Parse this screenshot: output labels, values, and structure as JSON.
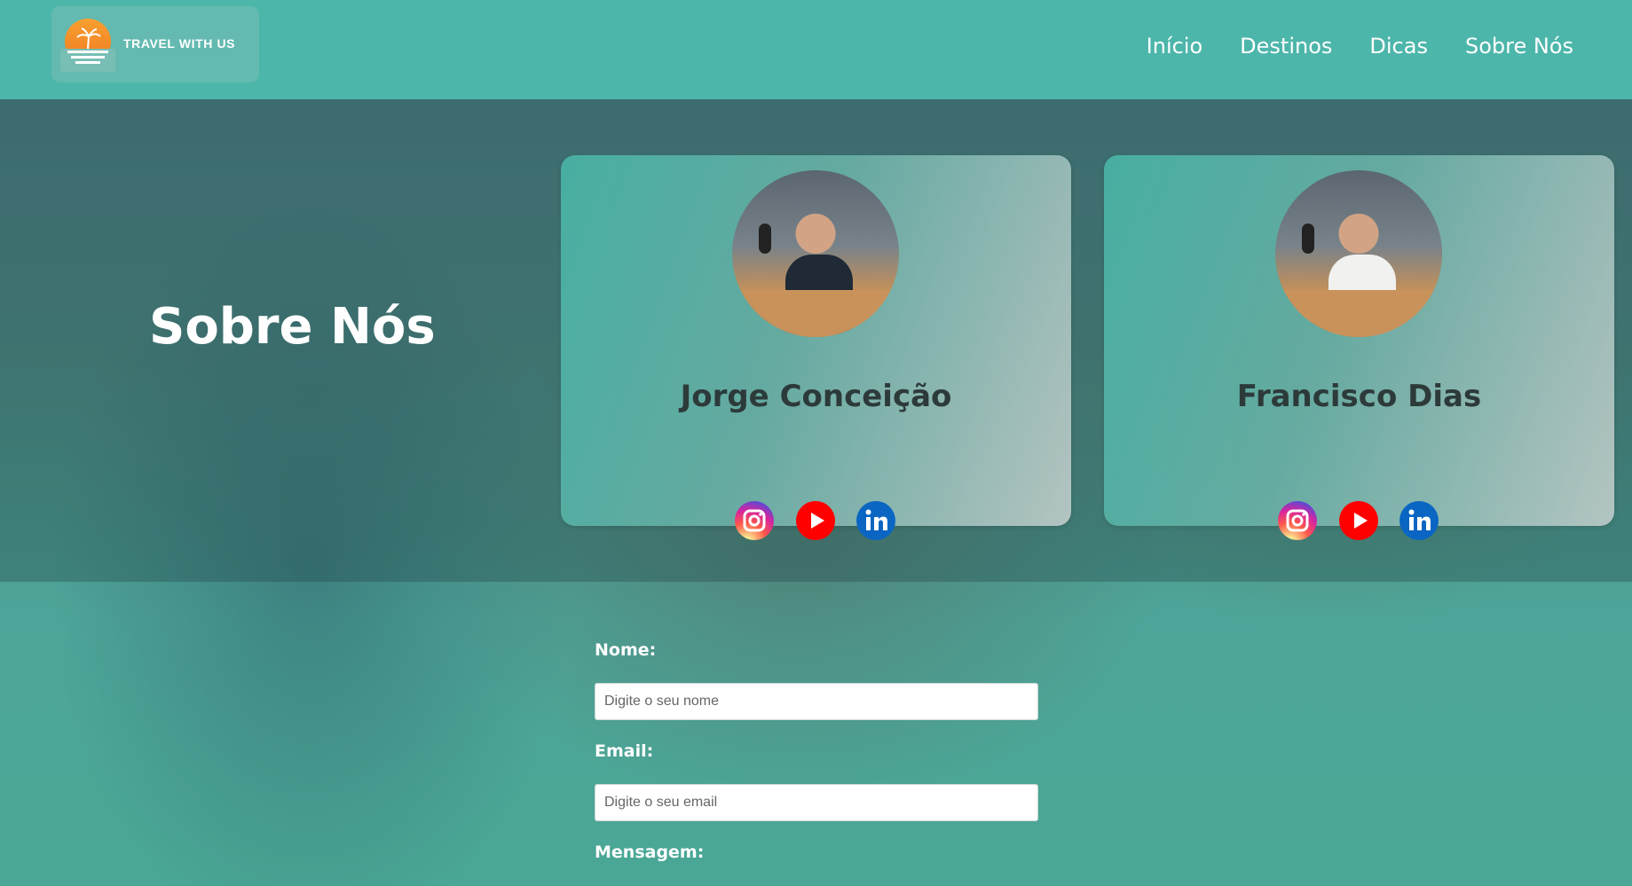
{
  "header": {
    "logo_text": "TRAVEL WITH US",
    "nav": [
      "Início",
      "Destinos",
      "Dicas",
      "Sobre Nós"
    ]
  },
  "hero": {
    "title": "Sobre Nós",
    "members": [
      {
        "name": "Jorge Conceição",
        "socials": [
          "instagram-icon",
          "youtube-icon",
          "linkedin-icon"
        ]
      },
      {
        "name": "Francisco Dias",
        "socials": [
          "instagram-icon",
          "youtube-icon",
          "linkedin-icon"
        ]
      }
    ]
  },
  "form": {
    "name_label": "Nome:",
    "name_placeholder": "Digite o seu nome",
    "email_label": "Email:",
    "email_placeholder": "Digite o seu email",
    "message_label": "Mensagem:"
  },
  "colors": {
    "header": "#4ebaae",
    "card_accent": "#48b2a4",
    "instagram": "#d6249f",
    "youtube": "#ff0000",
    "linkedin": "#0a66c2"
  }
}
